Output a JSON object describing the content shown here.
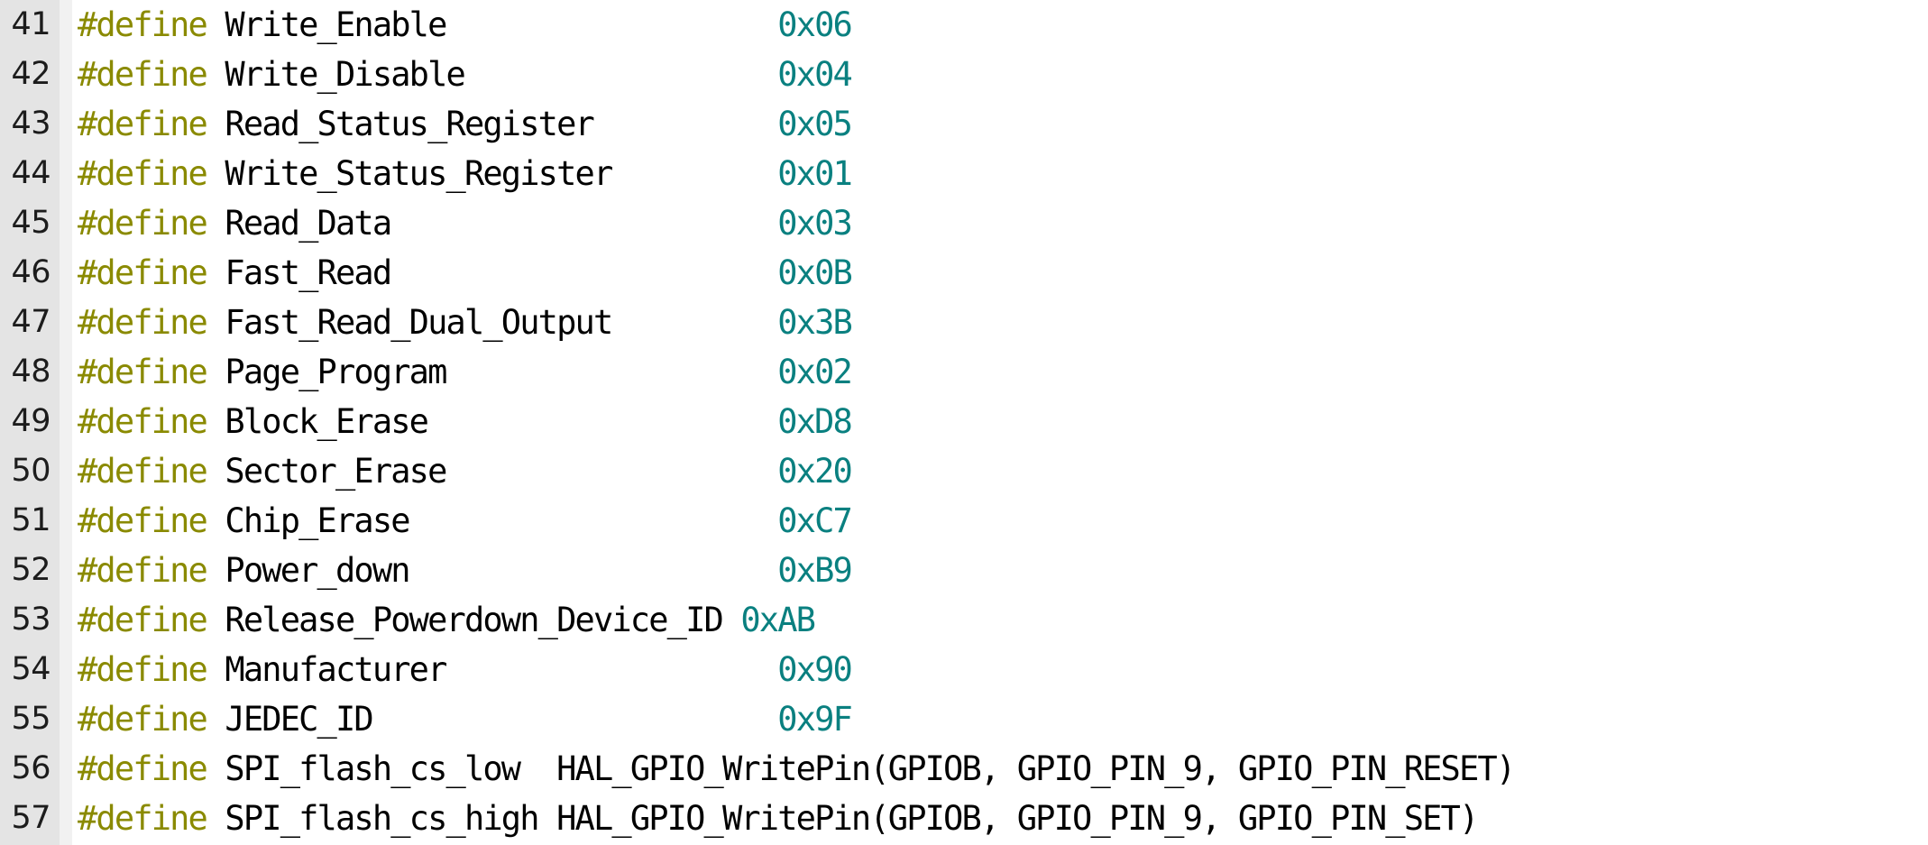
{
  "editor": {
    "language": "c",
    "first_line_number": 41,
    "colors": {
      "background": "#ffffff",
      "gutter_background": "#e4e4e4",
      "line_number": "#1c1c1c",
      "preprocessor_directive": "#8a8a00",
      "identifier": "#000000",
      "numeric_literal": "#0a8080"
    }
  },
  "lines": [
    {
      "number": "41",
      "directive": "#define",
      "name": "Write_Enable",
      "value": "0x06",
      "value_kind": "number",
      "gap": "                  ",
      "text": "#define Write_Enable                  0x06"
    },
    {
      "number": "42",
      "directive": "#define",
      "name": "Write_Disable",
      "value": "0x04",
      "value_kind": "number",
      "gap": "                 ",
      "text": "#define Write_Disable                 0x04"
    },
    {
      "number": "43",
      "directive": "#define",
      "name": "Read_Status_Register",
      "value": "0x05",
      "value_kind": "number",
      "gap": "          ",
      "text": "#define Read_Status_Register          0x05"
    },
    {
      "number": "44",
      "directive": "#define",
      "name": "Write_Status_Register",
      "value": "0x01",
      "value_kind": "number",
      "gap": "         ",
      "text": "#define Write_Status_Register         0x01"
    },
    {
      "number": "45",
      "directive": "#define",
      "name": "Read_Data",
      "value": "0x03",
      "value_kind": "number",
      "gap": "                     ",
      "text": "#define Read_Data                     0x03"
    },
    {
      "number": "46",
      "directive": "#define",
      "name": "Fast_Read",
      "value": "0x0B",
      "value_kind": "number",
      "gap": "                     ",
      "text": "#define Fast_Read                     0x0B"
    },
    {
      "number": "47",
      "directive": "#define",
      "name": "Fast_Read_Dual_Output",
      "value": "0x3B",
      "value_kind": "number",
      "gap": "         ",
      "text": "#define Fast_Read_Dual_Output         0x3B"
    },
    {
      "number": "48",
      "directive": "#define",
      "name": "Page_Program",
      "value": "0x02",
      "value_kind": "number",
      "gap": "                  ",
      "text": "#define Page_Program                  0x02"
    },
    {
      "number": "49",
      "directive": "#define",
      "name": "Block_Erase",
      "value": "0xD8",
      "value_kind": "number",
      "gap": "                   ",
      "text": "#define Block_Erase                   0xD8"
    },
    {
      "number": "50",
      "directive": "#define",
      "name": "Sector_Erase",
      "value": "0x20",
      "value_kind": "number",
      "gap": "                  ",
      "text": "#define Sector_Erase                  0x20"
    },
    {
      "number": "51",
      "directive": "#define",
      "name": "Chip_Erase",
      "value": "0xC7",
      "value_kind": "number",
      "gap": "                    ",
      "text": "#define Chip_Erase                    0xC7"
    },
    {
      "number": "52",
      "directive": "#define",
      "name": "Power_down",
      "value": "0xB9",
      "value_kind": "number",
      "gap": "                    ",
      "text": "#define Power_down                    0xB9"
    },
    {
      "number": "53",
      "directive": "#define",
      "name": "Release_Powerdown_Device_ID",
      "value": "0xAB",
      "value_kind": "number",
      "gap": " ",
      "text": "#define Release_Powerdown_Device_ID 0xAB"
    },
    {
      "number": "54",
      "directive": "#define",
      "name": "Manufacturer",
      "value": "0x90",
      "value_kind": "number",
      "gap": "                  ",
      "text": "#define Manufacturer                  0x90"
    },
    {
      "number": "55",
      "directive": "#define",
      "name": "JEDEC_ID",
      "value": "0x9F",
      "value_kind": "number",
      "gap": "                      ",
      "text": "#define JEDEC_ID                      0x9F"
    },
    {
      "number": "56",
      "directive": "#define",
      "name": "SPI_flash_cs_low",
      "value": "HAL_GPIO_WritePin(GPIOB, GPIO_PIN_9, GPIO_PIN_RESET)",
      "value_kind": "plain",
      "gap": "  ",
      "text": "#define SPI_flash_cs_low  HAL_GPIO_WritePin(GPIOB, GPIO_PIN_9, GPIO_PIN_RESET)"
    },
    {
      "number": "57",
      "directive": "#define",
      "name": "SPI_flash_cs_high",
      "value": "HAL_GPIO_WritePin(GPIOB, GPIO_PIN_9, GPIO_PIN_SET)",
      "value_kind": "plain",
      "gap": " ",
      "text": "#define SPI_flash_cs_high HAL_GPIO_WritePin(GPIOB, GPIO_PIN_9, GPIO_PIN_SET)"
    }
  ]
}
